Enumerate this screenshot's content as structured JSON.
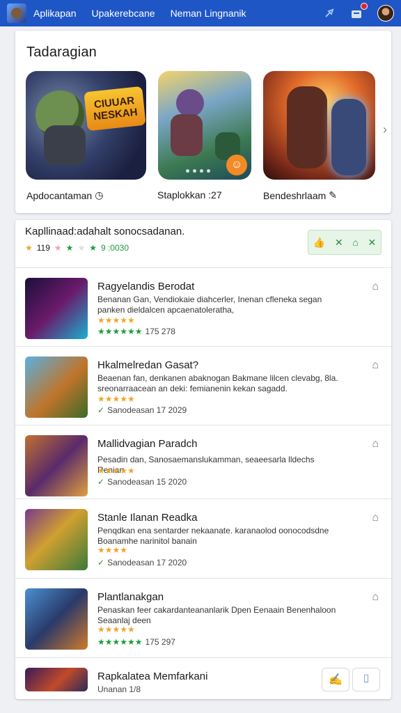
{
  "topbar": {
    "nav": [
      "Aplikapan",
      "Upakerebcane",
      "Neman Lingnanik"
    ],
    "notif_count": ""
  },
  "featured": {
    "title": "Tadaragian",
    "logo_text": [
      "CIUUAR",
      "NESKAH"
    ],
    "items": [
      {
        "caption": "Apdocantaman",
        "icon": "clock-icon"
      },
      {
        "caption": "Staplokkan :27",
        "icon": ""
      },
      {
        "caption": "Bendeshrlaam",
        "icon": "pencil-icon"
      }
    ]
  },
  "list": {
    "header_title": "Kapllinaad:adahalt sonocsadanan.",
    "header_rating": "119",
    "header_rating_green": "9 :0030",
    "rows": [
      {
        "title": "Ragyelandis Berodat",
        "desc": "Benanan Gan, Vendiokaie diahcerler, Inenan cfleneka segan panken dieldalcen apcaenatoleratha,",
        "rating_text": "175 278",
        "thumb": "linear-gradient(135deg,#1a0f3a,#6a1a6a 50%,#1ab0d0)"
      },
      {
        "title": "Hkalmelredan Gasat?",
        "desc": "Beaenan fan, denkanen abaknogan Bakmane lilcen clevabg, 8la. sreonarraacean an deki: femianenin kekan sagadd.",
        "rating_text": "Sanodeasan 17 2029",
        "thumb": "linear-gradient(135deg,#5ab0e0,#c0742a 55%,#3a6a2a)"
      },
      {
        "title": "Mallidvagian Paradch",
        "desc": "Pesadin dan, Sanosaemanslukamman, seaeesarla lldechs Renian",
        "rating_text": "Sanodeasan 15 2020",
        "thumb": "linear-gradient(135deg,#c07030,#5a2a6a 50%,#e0a040)"
      },
      {
        "title": "Stanle Ilanan Readka",
        "desc": "Penqdkan ena sentarder nekaanate. karanaolod oonocodsdne Boanamhe narinitol banain",
        "rating_text": "Sanodeasan 17 2020",
        "thumb": "linear-gradient(135deg,#7a3a8a,#d0a030 45%,#3a7a3a)"
      },
      {
        "title": "Plantlanakgan",
        "desc": "Penaskan feer cakardanteananlarik Dpen Eenaain Benenhaloon Seaanlaj deen",
        "rating_text": "175 297",
        "thumb": "linear-gradient(135deg,#4a90d0,#2a3a6a 50%,#d07a2a)"
      },
      {
        "title": "Rapkalatea Memfarkani",
        "desc": "",
        "rating_text": "Unanan 1/8",
        "thumb": "linear-gradient(135deg,#3a1a5a,#c04a2a 55%,#2a2a5a)"
      }
    ]
  }
}
